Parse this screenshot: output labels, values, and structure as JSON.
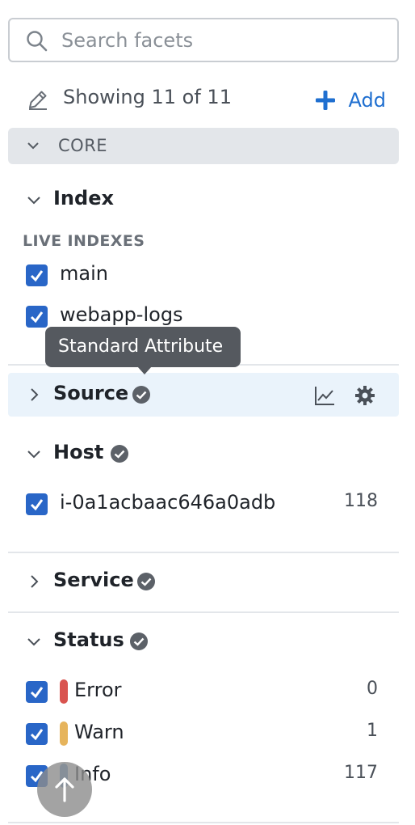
{
  "search": {
    "placeholder": "Search facets"
  },
  "toolbar": {
    "showing_text": "Showing 11 of 11",
    "add_label": "Add"
  },
  "section": {
    "label": "CORE"
  },
  "facets": {
    "index": {
      "name": "Index",
      "sub_label": "LIVE INDEXES",
      "values": [
        {
          "label": "main"
        },
        {
          "label": "webapp-logs"
        }
      ]
    },
    "source": {
      "name": "Source",
      "tooltip": "Standard Attribute"
    },
    "host": {
      "name": "Host",
      "values": [
        {
          "label": "i-0a1acbaac646a0adb",
          "count": "118"
        }
      ]
    },
    "service": {
      "name": "Service"
    },
    "status": {
      "name": "Status",
      "values": [
        {
          "label": "Error",
          "count": "0",
          "color": "#d9534f"
        },
        {
          "label": "Warn",
          "count": "1",
          "color": "#e6b45c"
        },
        {
          "label": "Info",
          "count": "117",
          "color": "#6d9ccd"
        }
      ]
    }
  },
  "colors": {
    "accent": "#1f6fd0",
    "checkbox": "#2966c7",
    "hover_row": "#eaf3fb",
    "section_bg": "#e3e6ea"
  },
  "icons": [
    "search-icon",
    "pencil-icon",
    "plus-icon",
    "chevron-down-icon",
    "chevron-right-icon",
    "verified-check-icon",
    "chart-icon",
    "gear-icon",
    "arrow-up-icon"
  ]
}
